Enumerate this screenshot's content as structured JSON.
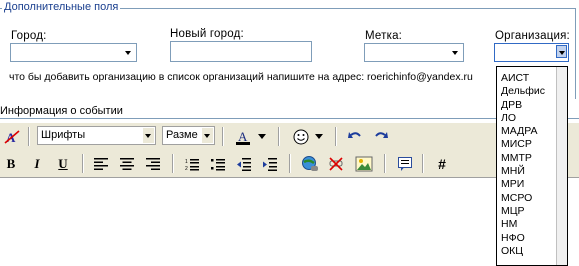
{
  "fieldset": {
    "legend": "Дополнительные поля"
  },
  "city": {
    "label": "Город:"
  },
  "new_city": {
    "label": "Новый город:"
  },
  "tag": {
    "label": "Метка:"
  },
  "organization": {
    "label": "Организация:",
    "options": [
      "АИСТ",
      "Дельфис",
      "ДРВ",
      "ЛО",
      "МАДРА",
      "МИСР",
      "ММТР",
      "МНЙ",
      "МРИ",
      "МСРО",
      "МЦР",
      "НМ",
      "НФО",
      "ОКЦ"
    ]
  },
  "hint": "что бы добавить организацию в список организаций напишите на адрес: roerichinfo@yandex.ru",
  "event": {
    "label": "Информация о событии"
  },
  "editor": {
    "font_select": "Шрифты",
    "size_select": "Разме",
    "bold": "B",
    "italic": "I",
    "underline": "U",
    "hash": "#"
  },
  "colors": {
    "legend": "#1a3f8f",
    "border": "#7f9db9",
    "toolbar": "#ece9d8"
  }
}
